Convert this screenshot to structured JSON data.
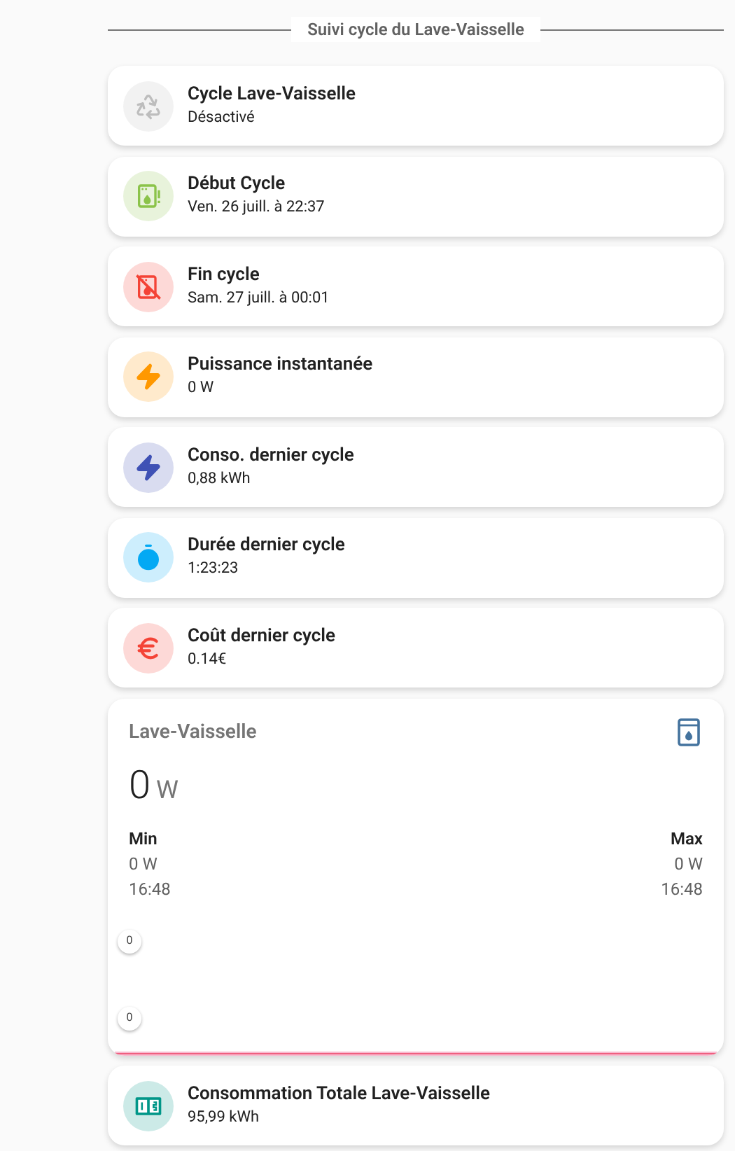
{
  "section_title": "Suivi cycle du Lave-Vaisselle",
  "tiles": [
    {
      "kind": "recycle",
      "color": "#bdbdbd",
      "name": "Cycle Lave-Vaisselle",
      "state": "Désactivé"
    },
    {
      "kind": "appliance_alert",
      "color": "#8bc34a",
      "name": "Début Cycle",
      "state": "Ven. 26 juill. à 22:37"
    },
    {
      "kind": "appliance_off",
      "color": "#f44336",
      "name": "Fin cycle",
      "state": "Sam. 27 juill. à 00:01"
    },
    {
      "kind": "bolt",
      "color": "#ff9800",
      "name": "Puissance instantanée",
      "state": "0 W"
    },
    {
      "kind": "bolt",
      "color": "#3f51b5",
      "name": "Conso. dernier cycle",
      "state": "0,88 kWh"
    },
    {
      "kind": "timer",
      "color": "#03a9f4",
      "name": "Durée dernier cycle",
      "state": "1:23:23"
    },
    {
      "kind": "euro",
      "color": "#f44336",
      "name": "Coût dernier cycle",
      "state": "0.14€"
    }
  ],
  "sensor_card": {
    "title": "Lave-Vaisselle",
    "value": "0",
    "unit": "W",
    "min": {
      "label": "Min",
      "value": "0 W",
      "time": "16:48"
    },
    "max": {
      "label": "Max",
      "value": "0 W",
      "time": "16:48"
    },
    "axis_labels": [
      "0",
      "0"
    ]
  },
  "footer_tiles": [
    {
      "kind": "counter",
      "color": "#009688",
      "name": "Consommation Totale Lave-Vaisselle",
      "state": "95,99 kWh"
    }
  ]
}
